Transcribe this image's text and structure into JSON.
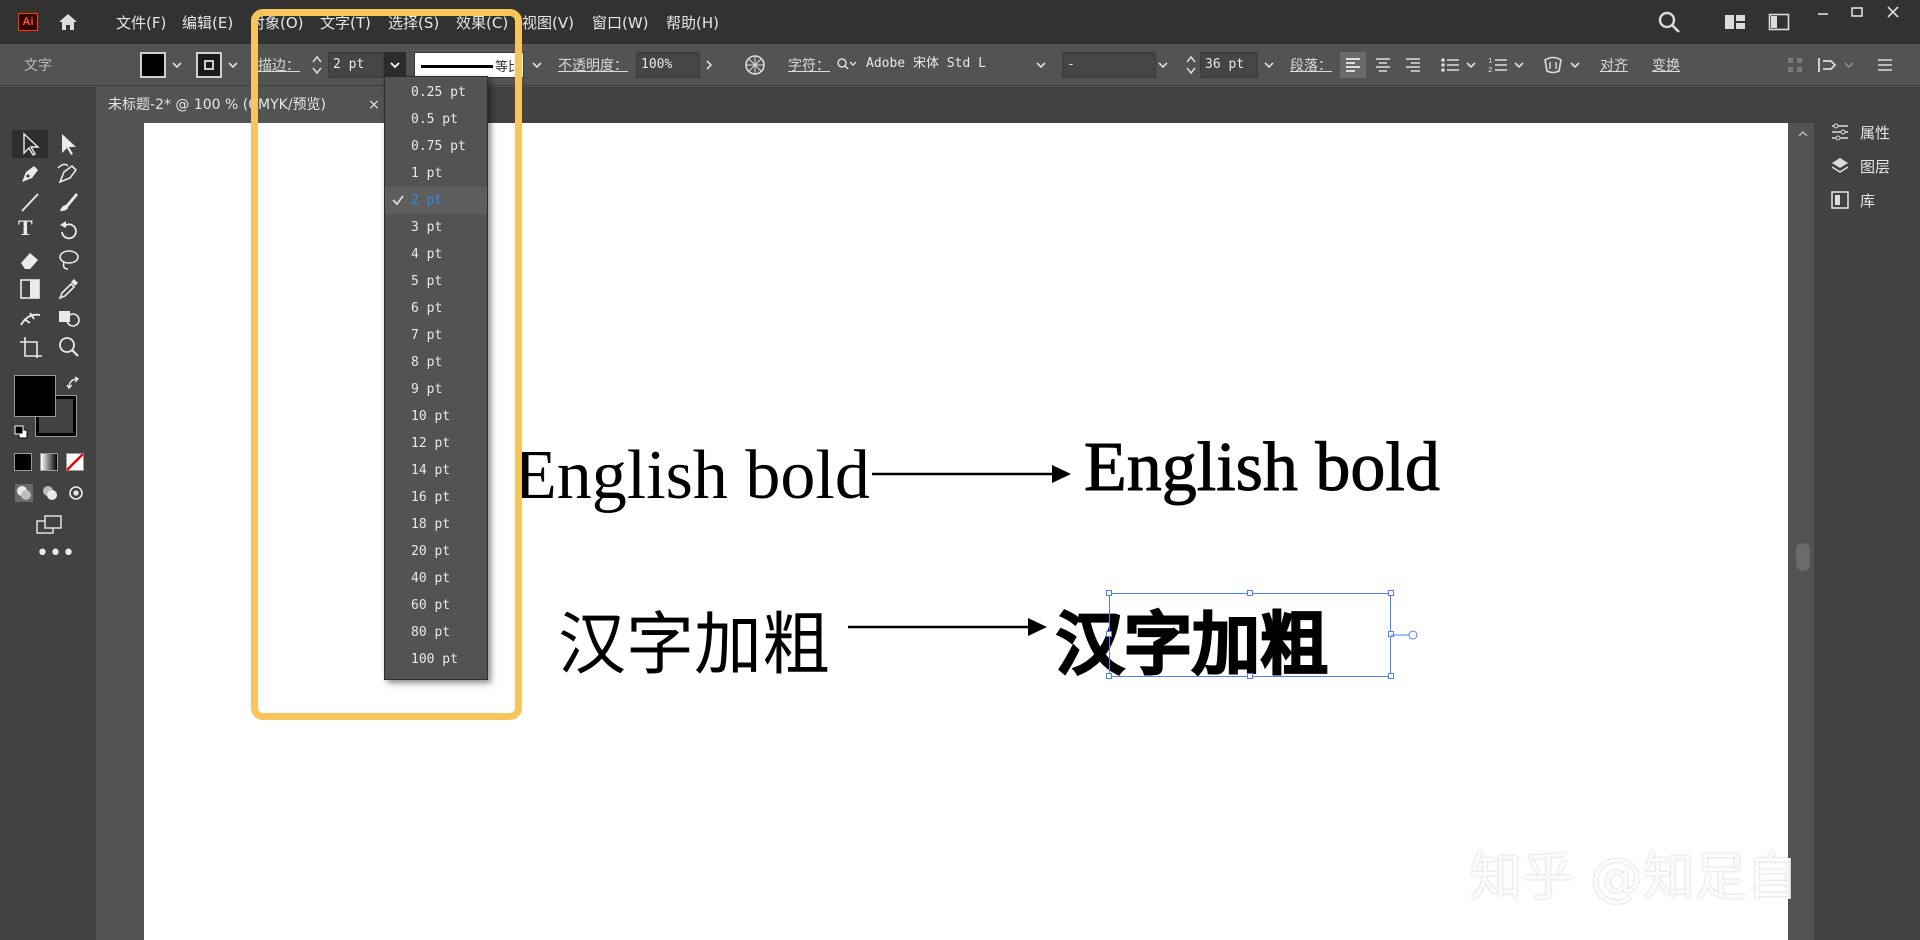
{
  "app": {
    "logo": "Ai"
  },
  "menu": [
    "文件(F)",
    "编辑(E)",
    "对象(O)",
    "文字(T)",
    "选择(S)",
    "效果(C)",
    "视图(V)",
    "窗口(W)",
    "帮助(H)"
  ],
  "control": {
    "tool_label": "文字",
    "stroke_label": "描边：",
    "stroke_value": "2 pt",
    "profile_label": "等比",
    "opacity_label": "不透明度：",
    "opacity_value": "100%",
    "char_label": "字符：",
    "font_name": "Adobe 宋体 Std L",
    "font_style": "-",
    "font_size": "36 pt",
    "para_label": "段落：",
    "align_label": "对齐",
    "transform_label": "变换"
  },
  "document": {
    "tab_title": "未标题-2* @ 100 % (CMYK/预览)",
    "close_glyph": "×"
  },
  "stroke_dropdown": {
    "options": [
      "0.25 pt",
      "0.5 pt",
      "0.75 pt",
      "1 pt",
      "2 pt",
      "3 pt",
      "4 pt",
      "5 pt",
      "6 pt",
      "7 pt",
      "8 pt",
      "9 pt",
      "10 pt",
      "12 pt",
      "14 pt",
      "16 pt",
      "18 pt",
      "20 pt",
      "40 pt",
      "60 pt",
      "80 pt",
      "100 pt"
    ],
    "selected": "2 pt"
  },
  "artboard": {
    "english_regular": "English bold",
    "english_bold": "English bold",
    "chinese_regular": "汉字加粗",
    "chinese_bold": "汉字加粗"
  },
  "right_panel": [
    {
      "label": "属性",
      "icon": "properties-icon"
    },
    {
      "label": "图层",
      "icon": "layers-icon"
    },
    {
      "label": "库",
      "icon": "libraries-icon"
    }
  ],
  "watermark": "知乎 @知足自信",
  "colors": {
    "highlight": "#f9c45b",
    "selection": "#4f7dff",
    "accent": "#2d8ceb"
  }
}
